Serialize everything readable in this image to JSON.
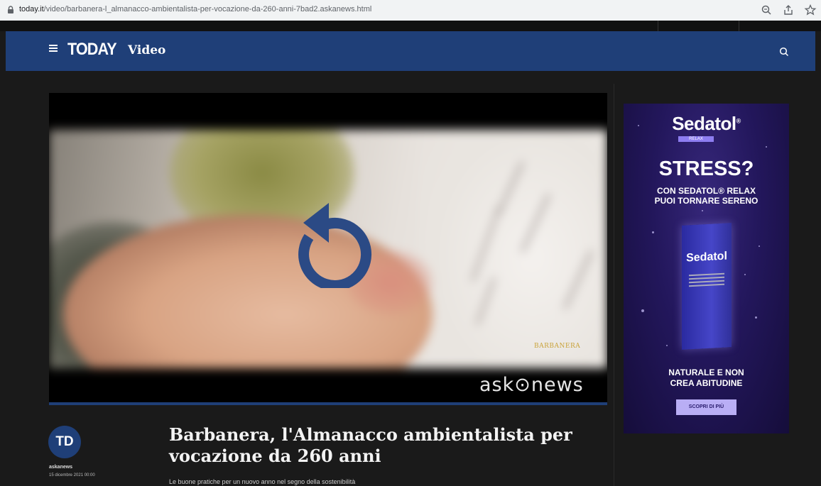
{
  "browser": {
    "url_host": "today.it",
    "url_path": "/video/barbanera-l_almanacco-ambientalista-per-vocazione-da-260-anni-7bad2.askanews.html"
  },
  "header": {
    "logo": "TODAY",
    "section": "Video"
  },
  "video": {
    "watermark": "BARBANERA",
    "provider_logo": "ask⊙news"
  },
  "article": {
    "avatar_initials": "TD",
    "author": "askanews",
    "date": "15 dicembre 2021 00:00",
    "title": "Barbanera, l'Almanacco ambientalista per vocazione da 260 anni",
    "subtitle": "Le buone pratiche per un nuovo anno nel segno della sostenibilità"
  },
  "ad": {
    "brand": "Sedatol",
    "brand_mark": "®",
    "relax_tag": "RELAX",
    "headline": "STRESS?",
    "subheadline_line1": "CON SEDATOL® RELAX",
    "subheadline_line2": "PUOI TORNARE SERENO",
    "box_brand": "Sedatol",
    "bottom_line1": "NATURALE E NON",
    "bottom_line2": "CREA ABITUDINE",
    "cta": "SCOPRI DI PIÙ",
    "bg_color": "#23175c"
  },
  "colors": {
    "nav": "#1f3f78",
    "page_bg": "#1a1a1a"
  },
  "icons": [
    "lock-icon",
    "zoom-icon",
    "share-icon",
    "bookmark-star-icon",
    "menu-icon",
    "search-icon",
    "replay-icon"
  ]
}
